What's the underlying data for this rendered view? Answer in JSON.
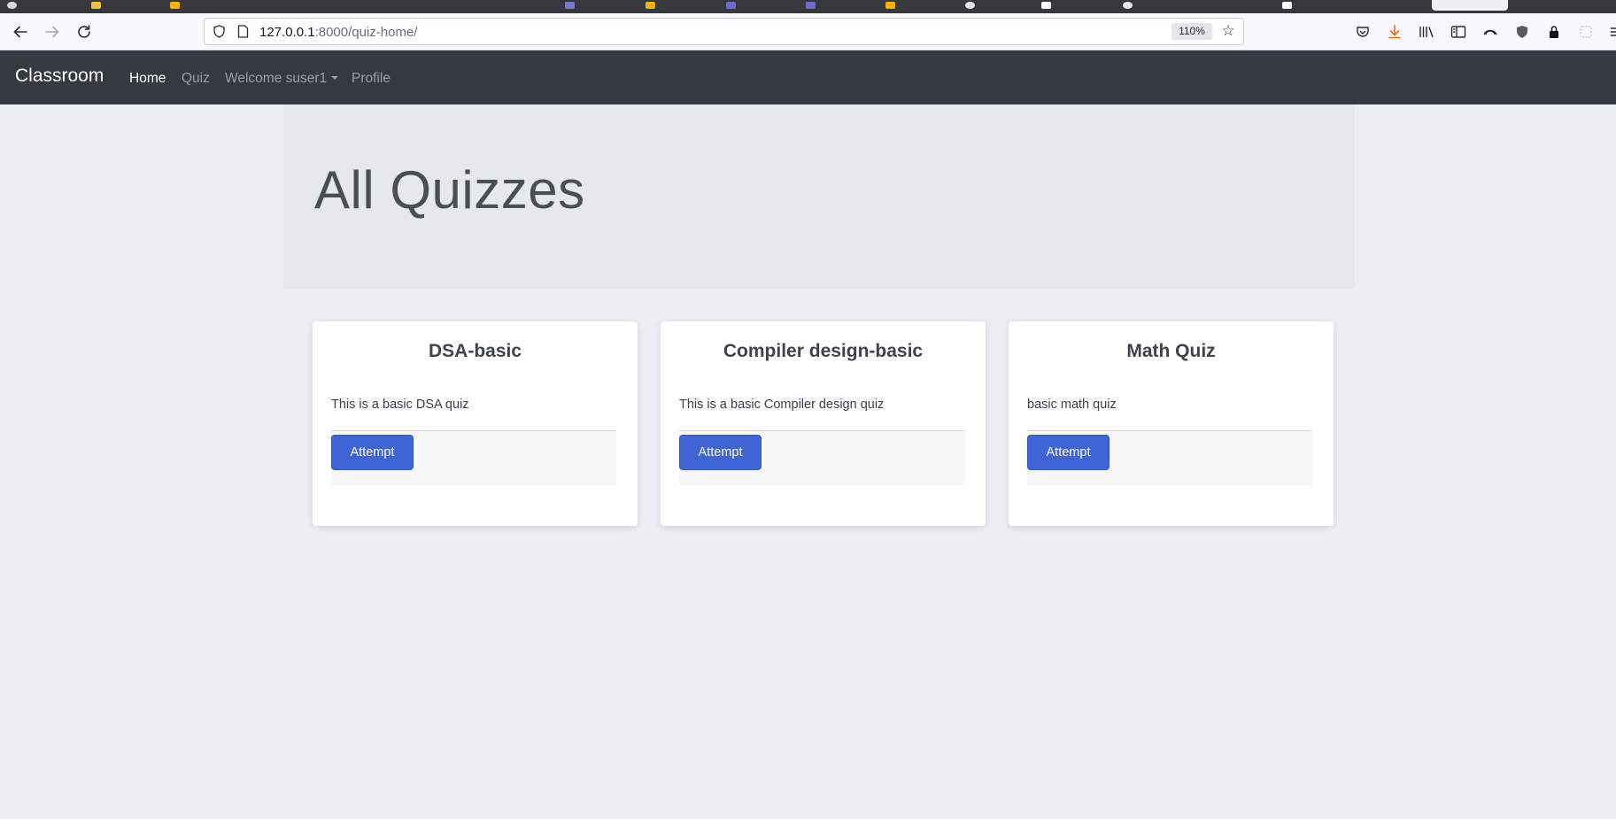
{
  "browser": {
    "url_host": "127.0.0.1",
    "url_path": ":8000/quiz-home/",
    "zoom": "110%",
    "icons": {
      "back": "back-arrow-icon",
      "forward": "forward-arrow-icon",
      "reload": "reload-icon",
      "shield": "shield-icon",
      "page": "page-icon",
      "bookmark": "star-icon",
      "pocket": "pocket-icon",
      "downloads": "download-icon",
      "library": "library-icon",
      "sidebar": "sidebar-icon",
      "sync": "sync-icon",
      "extension1": "shield-extension-icon",
      "extension2": "lock-extension-icon",
      "extension3": "extension-icon",
      "menu": "menu-icon"
    }
  },
  "navbar": {
    "brand": "Classroom",
    "links": {
      "home": "Home",
      "quiz": "Quiz",
      "welcome": "Welcome suser1",
      "profile": "Profile"
    }
  },
  "page": {
    "title": "All Quizzes"
  },
  "quizzes": [
    {
      "title": "DSA-basic",
      "description": "This is a basic DSA quiz",
      "button": "Attempt"
    },
    {
      "title": "Compiler design-basic",
      "description": "This is a basic Compiler design quiz",
      "button": "Attempt"
    },
    {
      "title": "Math Quiz",
      "description": "basic math quiz",
      "button": "Attempt"
    }
  ],
  "colors": {
    "navbar_bg": "#343a40",
    "page_bg": "#edf0f3",
    "jumbotron_bg": "#e6e9ec",
    "button_primary": "#3f64d5",
    "download_accent": "#e86a1c"
  }
}
